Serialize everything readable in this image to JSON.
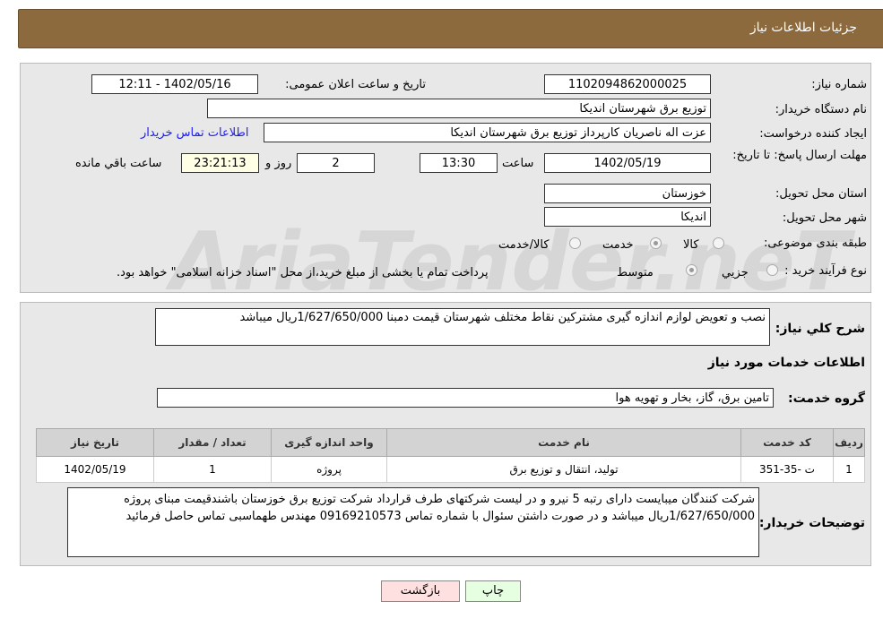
{
  "header": {
    "title": "جزئیات اطلاعات نیاز"
  },
  "fields": {
    "need_number_label": "شماره نیاز:",
    "need_number": "1102094862000025",
    "announce_label": "تاریخ و ساعت اعلان عمومی:",
    "announce_value": "1402/05/16 - 12:11",
    "buyer_org_label": "نام دستگاه خریدار:",
    "buyer_org": "توزیع برق شهرستان اندیکا",
    "creator_label": "ایجاد کننده درخواست:",
    "creator": "عزت اله ناصریان کارپرداز توزیع برق شهرستان اندیکا",
    "contact_link": "اطلاعات تماس خریدار",
    "deadline_label": "مهلت ارسال پاسخ: تا تاریخ:",
    "deadline_date": "1402/05/19",
    "time_label": "ساعت",
    "deadline_time": "13:30",
    "days": "2",
    "days_label": "روز و",
    "remaining": "23:21:13",
    "remaining_label": "ساعت باقي مانده",
    "province_label": "استان محل تحویل:",
    "province": "خوزستان",
    "city_label": "شهر محل تحویل:",
    "city": "اندیکا",
    "category_label": "طبقه بندی موضوعی:",
    "category_options": [
      "کالا",
      "خدمت",
      "کالا/خدمت"
    ],
    "category_selected": "خدمت",
    "process_label": "نوع فرآیند خرید :",
    "process_options": [
      "جزیي",
      "متوسط"
    ],
    "process_selected": "متوسط",
    "process_note": "پرداخت تمام یا بخشی از مبلغ خرید،از محل \"اسناد خزانه اسلامی\" خواهد بود."
  },
  "watermark": "AriaTender.neT",
  "details": {
    "summary_label": "شرح کلي نیاز:",
    "summary": "نصب و تعویض لوازم اندازه گیری مشترکین نقاط مختلف شهرستان قیمت دمبنا 1/627/650/000ریال میباشد",
    "services_title": "اطلاعات خدمات مورد نیاز",
    "group_label": "گروه خدمت:",
    "group": "تامین برق، گاز، بخار و تهویه هوا",
    "table": {
      "headers": [
        "ردیف",
        "کد خدمت",
        "نام خدمت",
        "واحد اندازه گیری",
        "تعداد / مقدار",
        "تاریخ نیاز"
      ],
      "rows": [
        [
          "1",
          "ت -35-351",
          "تولید، انتقال و توزیع برق",
          "پروژه",
          "1",
          "1402/05/19"
        ]
      ]
    },
    "notes_label": "توضیحات خریدار:",
    "notes": "شرکت کنندگان میبایست دارای رتبه 5 نیرو و در لیست شرکتهای طرف قرارداد شرکت توزیع برق خوزستان باشندقیمت مبنای پروژه 1/627/650/000ریال میباشد و در صورت داشتن سئوال با شماره تماس 09169210573 مهندس طهماسبی تماس حاصل فرمائید"
  },
  "buttons": {
    "print": "چاپ",
    "back": "بازگشت"
  }
}
